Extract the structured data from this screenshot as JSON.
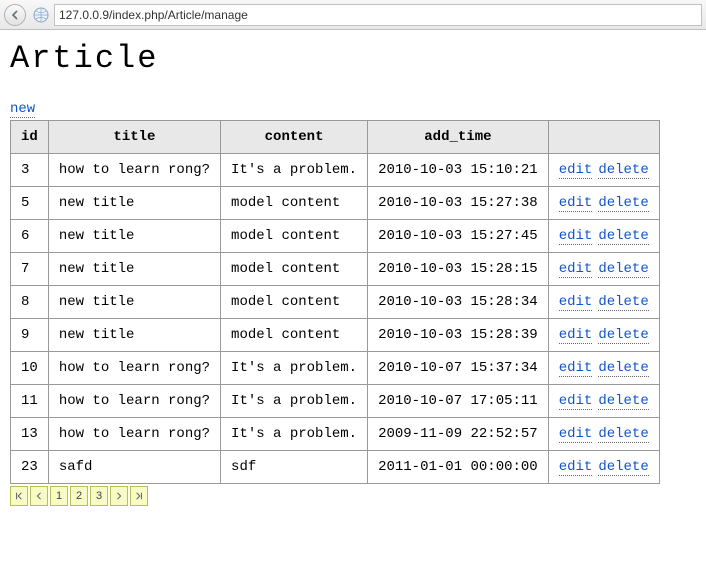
{
  "browser": {
    "url": "127.0.0.9/index.php/Article/manage"
  },
  "header": {
    "title": "Article",
    "new_link": "new"
  },
  "table": {
    "headers": {
      "id": "id",
      "title": "title",
      "content": "content",
      "add_time": "add_time",
      "actions": ""
    },
    "action_labels": {
      "edit": "edit",
      "delete": "delete"
    },
    "rows": [
      {
        "id": "3",
        "title": "how to learn rong?",
        "content": "It's a problem.",
        "add_time": "2010-10-03 15:10:21"
      },
      {
        "id": "5",
        "title": "new title",
        "content": "model content",
        "add_time": "2010-10-03 15:27:38"
      },
      {
        "id": "6",
        "title": "new title",
        "content": "model content",
        "add_time": "2010-10-03 15:27:45"
      },
      {
        "id": "7",
        "title": "new title",
        "content": "model content",
        "add_time": "2010-10-03 15:28:15"
      },
      {
        "id": "8",
        "title": "new title",
        "content": "model content",
        "add_time": "2010-10-03 15:28:34"
      },
      {
        "id": "9",
        "title": "new title",
        "content": "model content",
        "add_time": "2010-10-03 15:28:39"
      },
      {
        "id": "10",
        "title": "how to learn rong?",
        "content": "It's a problem.",
        "add_time": "2010-10-07 15:37:34"
      },
      {
        "id": "11",
        "title": "how to learn rong?",
        "content": "It's a problem.",
        "add_time": "2010-10-07 17:05:11"
      },
      {
        "id": "13",
        "title": "how to learn rong?",
        "content": "It's a problem.",
        "add_time": "2009-11-09 22:52:57"
      },
      {
        "id": "23",
        "title": "safd",
        "content": "sdf",
        "add_time": "2011-01-01 00:00:00"
      }
    ]
  },
  "pager": {
    "pages": [
      "1",
      "2",
      "3"
    ]
  }
}
